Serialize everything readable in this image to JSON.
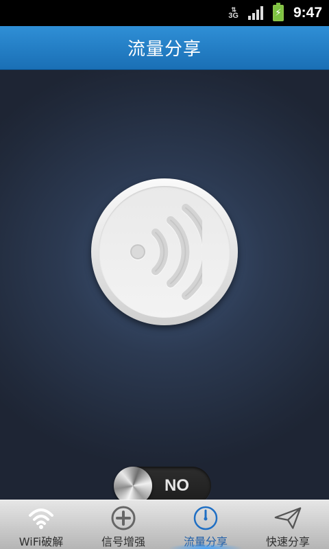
{
  "status_bar": {
    "network_type": "3G",
    "network_arrows": "⇅",
    "time": "9:47"
  },
  "header": {
    "title": "流量分享"
  },
  "main": {
    "share_button_icon": "wifi-broadcast-icon",
    "toggle": {
      "label": "NO",
      "state": "off"
    }
  },
  "bottom_nav": {
    "items": [
      {
        "label": "WiFi破解",
        "icon": "wifi-icon",
        "active": false
      },
      {
        "label": "信号增强",
        "icon": "plus-circle-icon",
        "active": false
      },
      {
        "label": "流量分享",
        "icon": "clock-icon",
        "active": true
      },
      {
        "label": "快速分享",
        "icon": "paper-plane-icon",
        "active": false
      }
    ]
  },
  "colors": {
    "title_bar": "#1a6fb5",
    "active_nav": "#1f5ea8",
    "battery": "#7cc341"
  }
}
